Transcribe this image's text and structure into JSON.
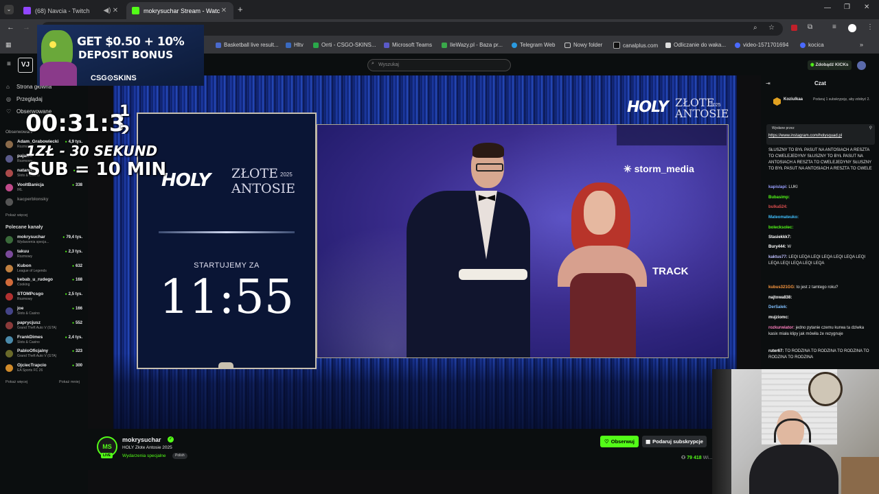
{
  "browser": {
    "tabs": [
      {
        "title": "(68) Navcia - Twitch",
        "active": false
      },
      {
        "title": "mokrysuchar Stream - Watch Li",
        "active": true
      }
    ],
    "bookmarks": [
      "Basketball live result...",
      "Hltv",
      "Orrti - CSGO-SKINS...",
      "Microsoft Teams",
      "IleWazy.pl - Baza pr...",
      "Telegram Web",
      "Nowy folder",
      "canalplus.com",
      "Odliczanie do waka...",
      "video-1571701694",
      "kocica"
    ]
  },
  "ad": {
    "headline": "GET $0.50 + 10%",
    "subline": "DEPOSIT BONUS",
    "brand": "CSG⊙SKINS"
  },
  "overlay": {
    "timer": "00:31:3",
    "digits": "1\n2",
    "rate1": "1ZŁ - 30 SEKUND",
    "rate2": "SUB = 10 MIN"
  },
  "kick": {
    "logo": "VJ",
    "search_placeholder": "Wyszukaj",
    "claim_label": "Zdobądź KICKs"
  },
  "sidebar": {
    "nav": [
      "Strona główna",
      "Przeglądaj",
      "Obserwowane"
    ],
    "followed_title": "Obserwowani",
    "followed": [
      {
        "name": "Adam_Grabowiecki",
        "game": "Rozmowy",
        "viewers": "4,9 tys.",
        "color": "#8a6a4a"
      },
      {
        "name": "pajalek",
        "game": "Rozmowy",
        "viewers": "",
        "color": "#5a5a8a"
      },
      {
        "name": "natanrr...",
        "game": "Slots & Casino",
        "viewers": "7...",
        "color": "#aa4a4a"
      },
      {
        "name": "VooltBanicja",
        "game": "IRL",
        "viewers": "338",
        "color": "#c04a8a"
      },
      {
        "name": "kacperblonsky",
        "game": "",
        "viewers": "",
        "color": "#555555"
      }
    ],
    "show_more": "Pokaż więcej",
    "recommended_title": "Polecane kanały",
    "recommended": [
      {
        "name": "mokrysuchar",
        "game": "Wydarzenia specja...",
        "viewers": "79,4 tys.",
        "color": "#3a6a3a"
      },
      {
        "name": "takuu",
        "game": "Rozmowy",
        "viewers": "2,3 tys.",
        "color": "#7a4a9a"
      },
      {
        "name": "Kubon",
        "game": "League of Legends",
        "viewers": "632",
        "color": "#c08040"
      },
      {
        "name": "kebab_u_rudego",
        "game": "Cooking",
        "viewers": "168",
        "color": "#d06a3a"
      },
      {
        "name": "STOMPcsgo",
        "game": "Rozmowy",
        "viewers": "2,5 tys.",
        "color": "#b03030"
      },
      {
        "name": "joe",
        "game": "Slots & Casino",
        "viewers": "166",
        "color": "#444488"
      },
      {
        "name": "paprycjusz",
        "game": "Grand Theft Auto V (GTA)",
        "viewers": "552",
        "color": "#8a3a3a"
      },
      {
        "name": "FrankDimes",
        "game": "Slots & Casino",
        "viewers": "2,4 tys.",
        "color": "#4a8aaa"
      },
      {
        "name": "PabloOficjalny",
        "game": "Grand Theft Auto V (GTA)",
        "viewers": "323",
        "color": "#6a6a2a"
      },
      {
        "name": "OjciecTrapcio",
        "game": "EA Sports FC 26",
        "viewers": "300",
        "color": "#d08a2a"
      }
    ],
    "footer_left": "Pokaż więcej",
    "footer_right": "Pokaż mniej"
  },
  "stream": {
    "panel_logo": "HOLY",
    "panel_title1": "ZŁOTE",
    "panel_title2": "ANTOSIE",
    "panel_year": "2025",
    "starting_label": "STARTUJEMY ZA",
    "countdown": "11:55",
    "stage_logo": "HOLY",
    "stage_title1": "ZŁOTE",
    "stage_title2": "ANTOSIE",
    "stage_year": "2025",
    "sponsor1": "storm_media",
    "sponsor2": "TRACK"
  },
  "channel": {
    "avatar": "MS",
    "live_badge": "LIVE",
    "name": "mokrysuchar",
    "title": "HOLY Złote Antosie 2025",
    "category": "Wydarzenia specjalne",
    "tag": "Polish",
    "follow_label": "Obserwuj",
    "gift_label": "Podaruj subskrypcje",
    "viewers": "79 418",
    "viewers_suffix": "Wi..."
  },
  "chat": {
    "title": "Czat",
    "top_user": "Koziulkaa",
    "top_msg": "Podaruj 1 subskrypcję, aby zdobyć 2.",
    "pinned_by": "Wysłane przez",
    "pinned_link": "https://www.instagram.com/holysquad.pl",
    "messages": [
      {
        "user": "",
        "text": "SŁUSZNY TO BYŁ PASUT NA ANTOSIACH A RESZTA TO CWELEJEDYNY SŁUSZNY TO BYŁ PASUT NA ANTOSIACH A RESZTA TO CWELEJEDYNY SŁUSZNY TO BYŁ PASUT NA ANTOSIACH A RESZTA TO CWELE",
        "color": "#ffffff"
      },
      {
        "user": "kapislapi:",
        "text": "LUKI",
        "color": "#9aa0ff"
      },
      {
        "user": "Bubasimp:",
        "text": "",
        "color": "#53fc18"
      },
      {
        "user": "bulka524:",
        "text": "",
        "color": "#e05050"
      },
      {
        "user": "Mateomateuko:",
        "text": "",
        "color": "#40c0ff"
      },
      {
        "user": "bolecksolec:",
        "text": "",
        "color": "#53fc18"
      },
      {
        "user": "Stasiekkk7:",
        "text": "",
        "color": "#ffffff"
      },
      {
        "user": "Bury444:",
        "text": "W",
        "color": "#ffffff"
      },
      {
        "user": "kaktus77:",
        "text": "LEQI LEQA LEQI LEQA LEQI LEQA LEQI LEQA LEQI LEQA LEQI LEQA",
        "color": "#c0c0ff"
      },
      {
        "user": "kubus321GG:",
        "text": "to jest z tamtego roku?",
        "color": "#ff9a40"
      },
      {
        "user": "najtowa838:",
        "text": "",
        "color": "#ffffff"
      },
      {
        "user": "DerSalek:",
        "text": "",
        "color": "#80c0ff"
      },
      {
        "user": "mujziomc:",
        "text": "",
        "color": "#ffffff"
      },
      {
        "user": "rozkurwiator:",
        "text": "jedno pytanie czemu kurwa ta dziwka kasix miała klipy jak mówiła że rezygnuje",
        "color": "#ff80c0"
      },
      {
        "user": "ruter67:",
        "text": "TO RODZINA TO RODZINA TO RODZINA TO RODZINA TO RODZINA",
        "color": "#ffffff"
      }
    ]
  },
  "colors": {
    "accent": "#53fc18",
    "background": "#0b0e0f",
    "browser": "#35363a"
  }
}
